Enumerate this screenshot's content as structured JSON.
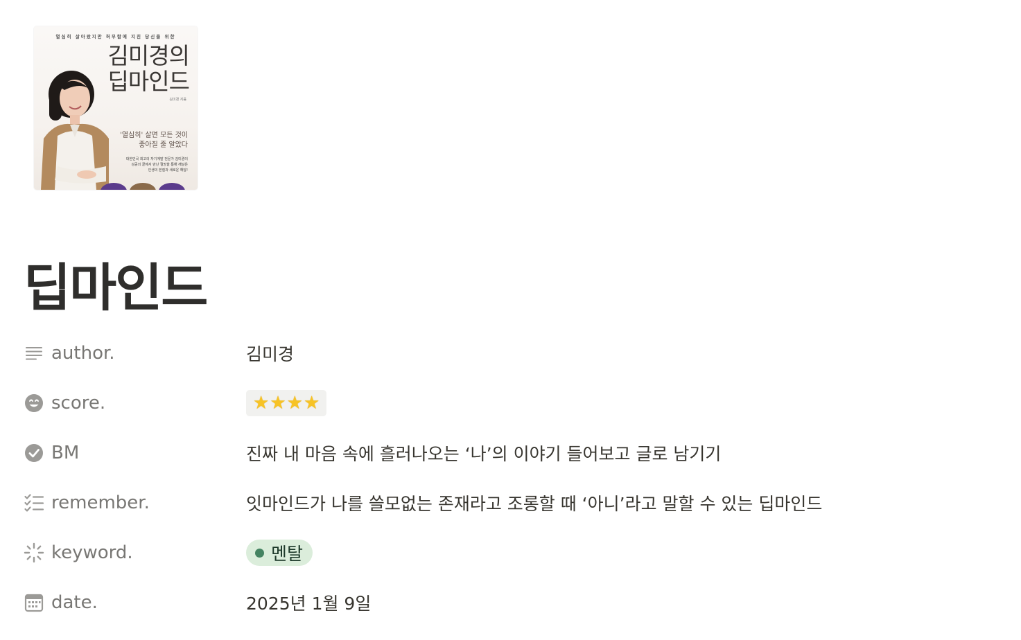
{
  "cover": {
    "tagline": "열심히 살아왔지만 허무함에 지친 당신을 위한",
    "title_line1": "김미경의",
    "title_line2": "딥마인드",
    "author": "김미경 지음",
    "quote_line1": "'열심히' 살면 모든 것이",
    "quote_line2": "좋아질 줄 알았다",
    "blurb_line1": "대한민국 최고의 자기계발 전문가 김미경이",
    "blurb_line2": "성공의 끝에서 만난 절망을 통해 깨달은",
    "blurb_line3": "인생의 본질과 새로운 해답!",
    "dot_colors": [
      "#5b3b8c",
      "#8a6a4a",
      "#5b3b8c"
    ]
  },
  "page": {
    "title": "딥마인드"
  },
  "properties": {
    "author": {
      "label": "author.",
      "icon": "text-lines-icon",
      "value": "김미경"
    },
    "score": {
      "label": "score.",
      "icon": "smiley-icon",
      "stars": "⭐⭐⭐⭐",
      "rating": 4
    },
    "bm": {
      "label": "BM",
      "icon": "check-circle-icon",
      "value": "진짜 내 마음 속에 흘러나오는 ‘나’의 이야기 들어보고 글로 남기기"
    },
    "remember": {
      "label": "remember.",
      "icon": "checklist-icon",
      "value": "잇마인드가 나를 쓸모없는 존재라고 조롱할 때 ‘아니’라고 말할 수 있는 딥마인드"
    },
    "keyword": {
      "label": "keyword.",
      "icon": "loading-spinner-icon",
      "tag": "멘탈",
      "tag_color": "#dbeddb",
      "tag_dot_color": "#448361"
    },
    "date": {
      "label": "date.",
      "icon": "calendar-icon",
      "value": "2025년 1월 9일"
    }
  }
}
